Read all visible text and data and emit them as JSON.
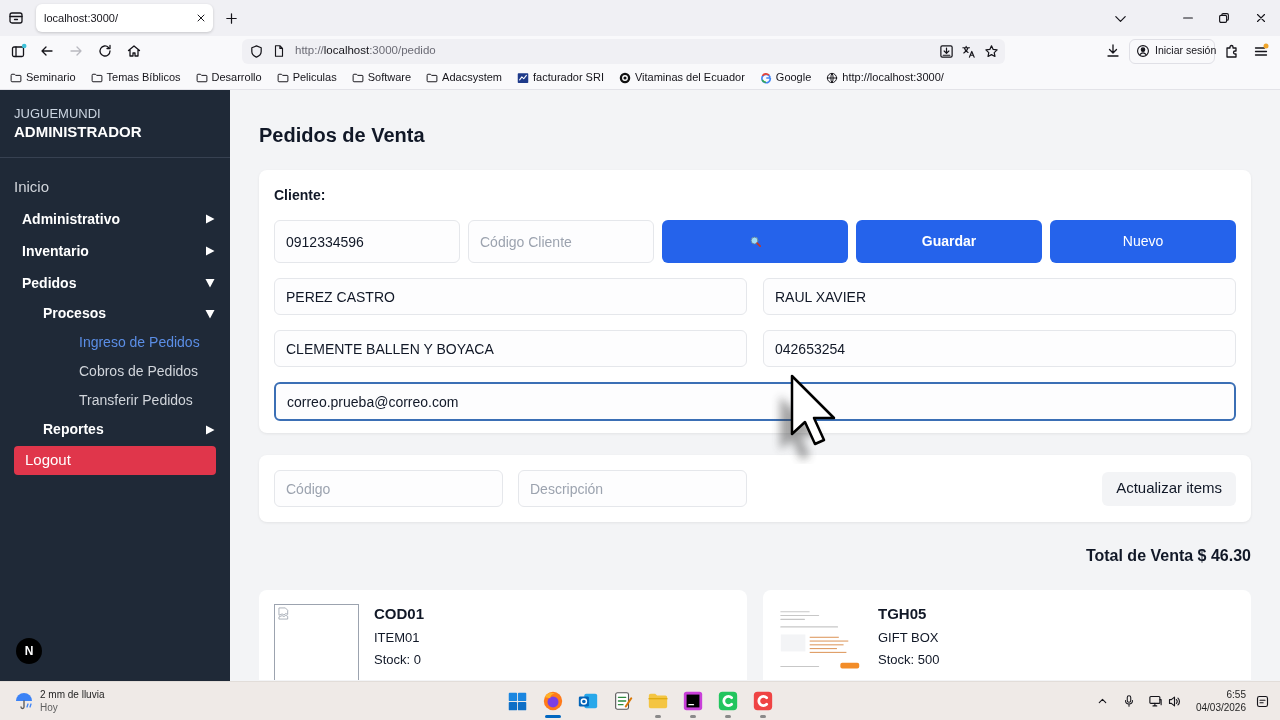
{
  "browser": {
    "tabs": [
      {
        "title": "localhost:3000/",
        "selected": true
      }
    ],
    "toolbar": {
      "back": {
        "disabled": false
      },
      "forward": {
        "disabled": true
      }
    },
    "url": "http://**localhost**:3000/pedido",
    "account_button": "Iniciar sesión",
    "bookmarks": [
      {
        "kind": "folder",
        "label": "Seminario"
      },
      {
        "kind": "folder",
        "label": "Temas Bíblicos"
      },
      {
        "kind": "folder",
        "label": "Desarrollo"
      },
      {
        "kind": "folder",
        "label": "Peliculas"
      },
      {
        "kind": "folder",
        "label": "Software"
      },
      {
        "kind": "folder",
        "label": "Adacsystem"
      },
      {
        "kind": "sri",
        "label": "facturador SRI"
      },
      {
        "kind": "ring",
        "label": "Vitaminas del Ecuador"
      },
      {
        "kind": "google",
        "label": "Google"
      },
      {
        "kind": "globe",
        "label": "http://localhost:3000/"
      }
    ]
  },
  "sidebar": {
    "brand": "JUGUEMUNDI",
    "role": "ADMINISTRADOR",
    "items": [
      {
        "kind": "link",
        "label": "Inicio",
        "selected": false
      },
      {
        "kind": "group",
        "label": "Administrativo",
        "selected": false,
        "expanded": false
      },
      {
        "kind": "group",
        "label": "Inventario",
        "selected": false,
        "expanded": false
      },
      {
        "kind": "group",
        "label": "Pedidos",
        "selected": false,
        "expanded": true,
        "children": [
          {
            "kind": "group",
            "label": "Procesos",
            "selected": false,
            "expanded": true,
            "children": [
              {
                "kind": "link",
                "label": "Ingreso de Pedidos",
                "selected": true
              },
              {
                "kind": "link",
                "label": "Cobros de Pedidos",
                "selected": false
              },
              {
                "kind": "link",
                "label": "Transferir Pedidos",
                "selected": false
              }
            ]
          },
          {
            "kind": "group",
            "label": "Reportes",
            "selected": false,
            "expanded": false
          }
        ]
      }
    ],
    "logout_button": "Logout",
    "dev_badge": "N"
  },
  "page": {
    "title": "Pedidos de Venta",
    "client_form": {
      "label": "Cliente:",
      "id_field": {
        "value": "0912334596"
      },
      "code_field": {
        "placeholder": "Código Cliente"
      },
      "buttons": [
        {
          "kind": "search"
        },
        {
          "kind": "text",
          "label": "Guardar",
          "default": true
        },
        {
          "kind": "text",
          "label": "Nuevo",
          "default": false
        }
      ],
      "rows": [
        [
          {
            "value": "PEREZ CASTRO",
            "focused": false
          },
          {
            "value": "RAUL XAVIER",
            "focused": false
          }
        ],
        [
          {
            "value": "CLEMENTE BALLEN Y BOYACA",
            "focused": false
          },
          {
            "value": "042653254",
            "focused": false
          }
        ],
        [
          {
            "value": "correo.prueba@correo.com",
            "focused": true
          }
        ]
      ]
    },
    "item_filter": {
      "code_field": {
        "placeholder": "Código"
      },
      "description_field": {
        "placeholder": "Descripción"
      },
      "update_button": "Actualizar items"
    },
    "total": "Total de Venta $ 46.30",
    "products": [
      {
        "kind": "broken_image",
        "code": "COD01",
        "description": "ITEM01",
        "stock": "Stock: 0"
      },
      {
        "kind": "thumbnail",
        "code": "TGH05",
        "description": "GIFT BOX",
        "stock": "Stock: 500"
      }
    ]
  },
  "taskbar": {
    "weather": {
      "text": "2 mm de lluvia",
      "subtext": "Hoy"
    },
    "apps": [
      {
        "kind": "browser",
        "running": true,
        "selected": true
      },
      {
        "kind": "mail",
        "running": false,
        "selected": false
      },
      {
        "kind": "notes",
        "running": false,
        "selected": false
      },
      {
        "kind": "files",
        "running": true,
        "selected": false
      },
      {
        "kind": "ide",
        "running": true,
        "selected": false
      },
      {
        "kind": "green_app",
        "running": true,
        "selected": false
      },
      {
        "kind": "red_app",
        "running": true,
        "selected": false
      }
    ],
    "time": "6:55",
    "date": "04/03/2026"
  }
}
